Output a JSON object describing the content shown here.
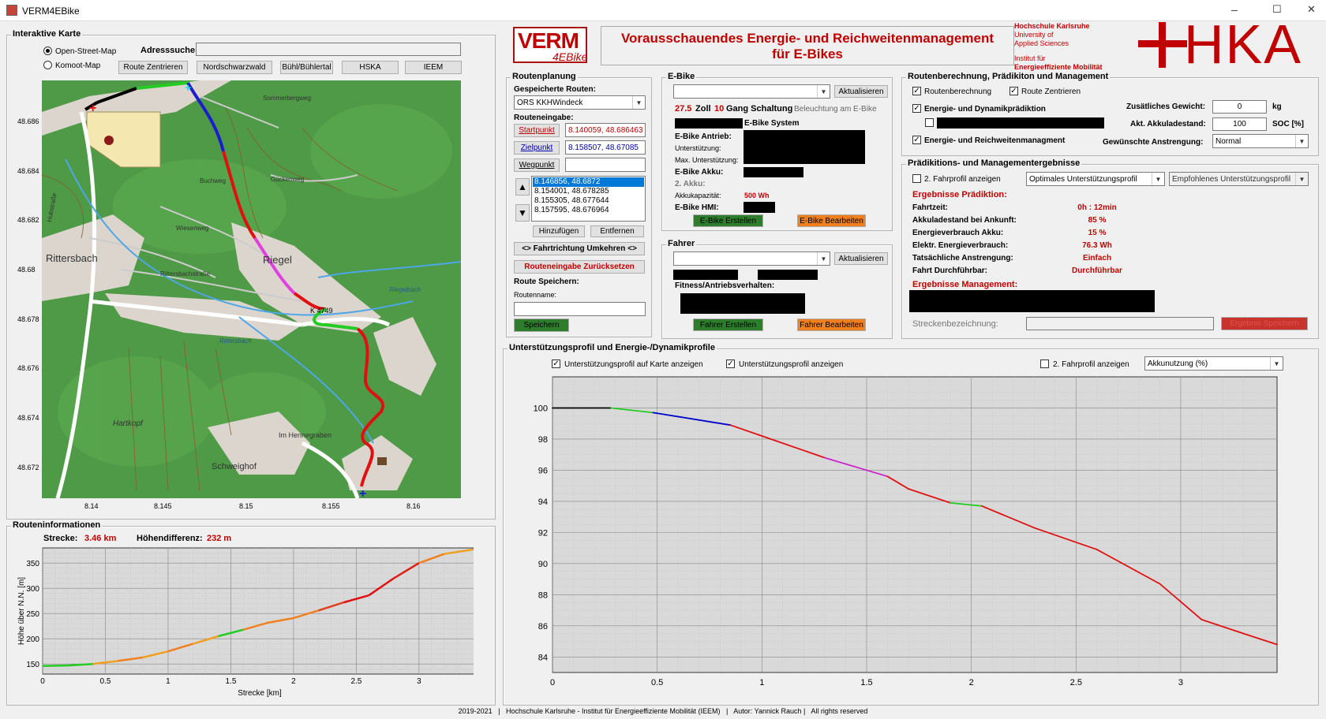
{
  "window": {
    "title": "VERM4EBike",
    "controls": [
      "–",
      "☐",
      "✕"
    ]
  },
  "map_panel": {
    "title": "Interaktive Karte",
    "radio_osm": "Open-Street-Map",
    "radio_komoot": "Komoot-Map",
    "address_label": "Adresssuche:",
    "address_value": "",
    "buttons": [
      "Route Zentrieren",
      "Nordschwarzwald",
      "Bühl/Bühlertal",
      "HSKA",
      "IEEM"
    ],
    "y_ticks": [
      "48.686",
      "48.684",
      "48.682",
      "48.68",
      "48.678",
      "48.676",
      "48.674",
      "48.672"
    ],
    "x_ticks": [
      "8.14",
      "8.145",
      "8.15",
      "8.155",
      "8.16"
    ],
    "map_labels": [
      "Rittersbach",
      "Riegel",
      "Schweighof",
      "Im Hennegraben",
      "Hartkopf",
      "Sommerbergweg",
      "Gückenweg",
      "Riegelbach",
      "Rittersbach",
      "K 4749",
      "Hubstraße",
      "Rittersbachstraße",
      "Buchweg",
      "Wiesenweg"
    ]
  },
  "route_info": {
    "title": "Routeninformationen",
    "distance_label": "Strecke:",
    "distance_value": "3.46 km",
    "height_label": "Höhendifferenz:",
    "height_value": "232 m",
    "ylabel": "Höhe über N.N. [m]",
    "xlabel": "Strecke [km]",
    "y_ticks": [
      "350",
      "300",
      "250",
      "200",
      "150"
    ],
    "x_ticks": [
      "0",
      "0.5",
      "1",
      "1.5",
      "2",
      "2.5",
      "3"
    ]
  },
  "header": {
    "logo_main": "VERM",
    "logo_sub": "4EBike",
    "title_line1": "Vorausschauendes Energie- und Reichweitenmanagement",
    "title_line2": "für E-Bikes",
    "hs_line1": "Hochschule Karlsruhe",
    "hs_line2": "University of",
    "hs_line3": "Applied Sciences",
    "hs_line4": "Institut für",
    "hs_line5": "Energieeffiziente Mobilität",
    "hka_logo": "HKA"
  },
  "routing": {
    "title": "Routenplanung",
    "saved_label": "Gespeicherte Routen:",
    "saved_value": "ORS KKHWindeck",
    "input_label": "Routeneingabe:",
    "start_btn": "Startpunkt",
    "start_value": "8.140059, 48.686463",
    "end_btn": "Zielpunkt",
    "end_value": "8.158507, 48.67085",
    "waypoint_btn": "Wegpunkt",
    "waypoint_value": "",
    "waypoints": [
      "8.146856, 48.6872",
      "8.154001, 48.678285",
      "8.155305, 48.677644",
      "8.157595, 48.676964"
    ],
    "add_btn": "Hinzufügen",
    "remove_btn": "Entfernen",
    "reverse_btn": "<> Fahrtrichtung Umkehren <>",
    "reset_btn": "Routeneingabe Zurücksetzen",
    "save_label": "Route Speichern:",
    "name_label": "Routenname:",
    "name_value": "",
    "save_btn": "Speichern"
  },
  "ebike": {
    "title": "E-Bike",
    "refresh_btn": "Aktualisieren",
    "wheel_value": "27.5",
    "wheel_unit": "Zoll",
    "gear_value": "10",
    "gear_unit": "Gang Schaltung",
    "light_label": "Beleuchtung am E-Bike",
    "system_label": "E-Bike System",
    "drive_label": "E-Bike Antrieb:",
    "support_label": "Unterstützung:",
    "max_support_label": "Max. Unterstützung:",
    "battery_label": "E-Bike Akku:",
    "battery2_label": "2. Akku:",
    "capacity_label": "Akkukapazität:",
    "capacity_value": "500 Wh",
    "hmi_label": "E-Bike HMI:",
    "create_btn": "E-Bike Erstellen",
    "edit_btn": "E-Bike Bearbeiten"
  },
  "rider": {
    "title": "Fahrer",
    "refresh_btn": "Aktualisieren",
    "fitness_label": "Fitness/Antriebsverhalten:",
    "create_btn": "Fahrer Erstellen",
    "edit_btn": "Fahrer Bearbeiten"
  },
  "calc": {
    "title": "Routenberechnung, Prädikiton und Management",
    "cb_route": "Routenberechnung",
    "cb_center": "Route Zentrieren",
    "cb_pred": "Energie- und Dynamikprädiktion",
    "cb_mgmt": "Energie- und Reichweitenmanagment",
    "weight_label": "Zusätliches Gewicht:",
    "weight_value": "0",
    "weight_unit": "kg",
    "soc_label": "Akt. Akkuladestand:",
    "soc_value": "100",
    "soc_unit": "SOC [%]",
    "effort_label": "Gewünschte Anstrengung:",
    "effort_value": "Normal"
  },
  "results": {
    "title": "Prädikitions- und Managementergebnisse",
    "cb_profile2": "2. Fahrprofil anzeigen",
    "dd_opt": "Optimales Unterstützungsprofil",
    "dd_rec": "Empfohlenes Unterstützungsprofil",
    "pred_title": "Ergebnisse Prädiktion:",
    "rows": [
      {
        "label": "Fahrtzeit:",
        "value": "0h : 12min"
      },
      {
        "label": "Akkuladestand bei Ankunft:",
        "value": "85 %"
      },
      {
        "label": "Energieverbrauch Akku:",
        "value": "15 %"
      },
      {
        "label": "Elektr. Energieverbrauch:",
        "value": "76.3 Wh"
      },
      {
        "label": "Tatsächliche Anstrengung:",
        "value": "Einfach"
      },
      {
        "label": "Fahrt Durchführbar:",
        "value": "Durchführbar"
      }
    ],
    "mgmt_title": "Ergebnisse Management:",
    "track_label": "Streckenbezeichnung:",
    "save_btn": "Ergebnis Speichern"
  },
  "profile": {
    "title": "Unterstützungsprofil und Energie-/Dynamikprofile",
    "cb_map": "Unterstützungsprofil auf Karte anzeigen",
    "cb_show": "Unterstützungsprofil anzeigen",
    "cb_profile2": "2. Fahrprofil anzeigen",
    "dd_value": "Akkunutzung (%)",
    "y_ticks": [
      "100",
      "98",
      "96",
      "94",
      "92",
      "90",
      "88",
      "86",
      "84"
    ],
    "x_ticks": [
      "0",
      "0.5",
      "1",
      "1.5",
      "2",
      "2.5",
      "3"
    ]
  },
  "footer": "2019-2021   |   Hochschule Karlsruhe - Institut für Energieeffiziente Mobilität (IEEM)   |   Autor: Yannick Rauch |   All rights reserved",
  "colors": {
    "accent_red": "#c00000",
    "green_btn": "#2d7d2d",
    "orange_btn": "#f07f1d",
    "map_green": "#4e9a46"
  },
  "chart_data": [
    {
      "type": "line",
      "title": "",
      "xlabel": "Strecke [km]",
      "ylabel": "Höhe über N.N. [m]",
      "xlim": [
        0,
        3.46
      ],
      "ylim": [
        130,
        380
      ],
      "x": [
        0,
        0.2,
        0.4,
        0.6,
        0.8,
        1.0,
        1.2,
        1.4,
        1.6,
        1.8,
        2.0,
        2.2,
        2.4,
        2.6,
        2.8,
        3.0,
        3.2,
        3.46
      ],
      "values": [
        146,
        147,
        150,
        156,
        163,
        175,
        190,
        205,
        218,
        232,
        241,
        256,
        272,
        286,
        320,
        350,
        368,
        378
      ]
    },
    {
      "type": "line",
      "title": "",
      "xlabel": "",
      "ylabel": "",
      "xlim": [
        0,
        3.46
      ],
      "ylim": [
        83,
        102
      ],
      "x": [
        0,
        0.28,
        0.48,
        0.85,
        1.0,
        1.3,
        1.6,
        1.7,
        1.9,
        2.05,
        2.3,
        2.6,
        2.9,
        3.1,
        3.3,
        3.46
      ],
      "values": [
        100,
        100,
        99.7,
        98.9,
        98.2,
        96.8,
        95.6,
        94.8,
        93.9,
        93.7,
        92.3,
        90.9,
        88.7,
        86.4,
        85.5,
        84.8
      ],
      "series_colors": [
        "#000000",
        "#22cc22",
        "#0000cc",
        "#e01010",
        "#cc22cc",
        "#e01010",
        "#22cc22",
        "#e01010"
      ]
    }
  ]
}
